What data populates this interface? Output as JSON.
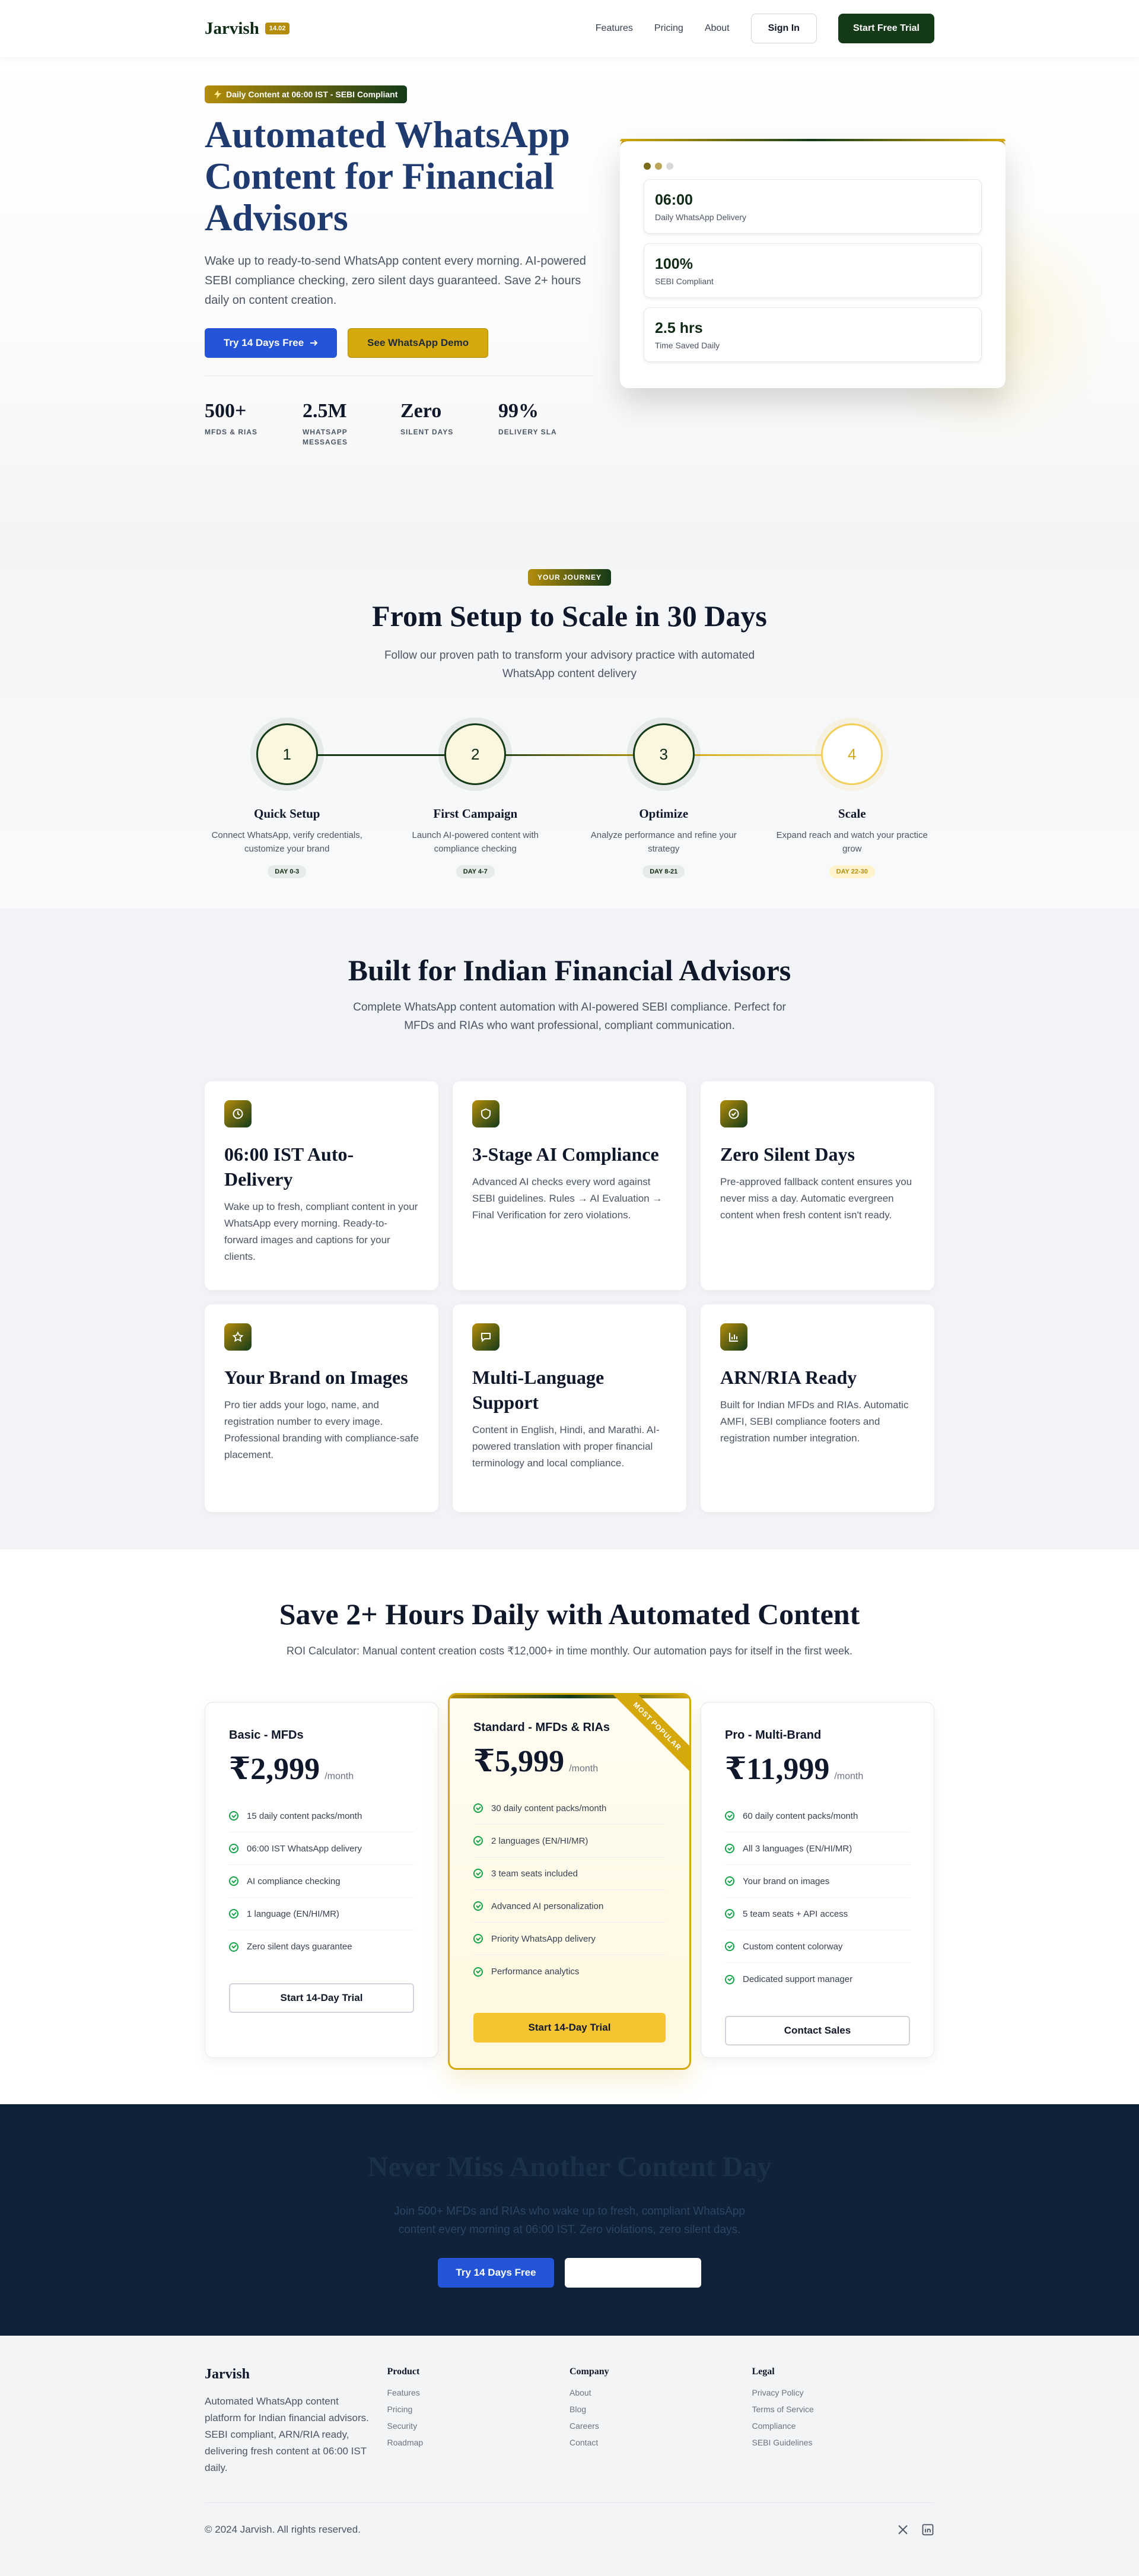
{
  "nav": {
    "brand": "Jarvish",
    "brand_badge": "14.02",
    "links": [
      "Features",
      "Pricing",
      "About"
    ],
    "signin": "Sign In",
    "trial": "Start Free Trial"
  },
  "hero": {
    "badge": "Daily Content at 06:00 IST - SEBI Compliant",
    "title": "Automated WhatsApp Content for Financial Advisors",
    "subtitle": "Wake up to ready-to-send WhatsApp content every morning. AI-powered SEBI compliance checking, zero silent days guaranteed. Save 2+ hours daily on content creation.",
    "cta_primary": "Try 14 Days Free",
    "cta_secondary": "See WhatsApp Demo",
    "stats": [
      {
        "value": "500+",
        "label": "MFDs & RIAs"
      },
      {
        "value": "2.5M",
        "label": "WhatsApp Messages"
      },
      {
        "value": "Zero",
        "label": "Silent Days"
      },
      {
        "value": "99%",
        "label": "Delivery SLA"
      }
    ],
    "mock_cards": [
      {
        "value": "06:00",
        "label": "Daily WhatsApp Delivery"
      },
      {
        "value": "100%",
        "label": "SEBI Compliant"
      },
      {
        "value": "2.5 hrs",
        "label": "Time Saved Daily"
      }
    ],
    "dot_colors": [
      "#7a6a1a",
      "#b8a55a",
      "#d7d7d7"
    ]
  },
  "journey": {
    "pill": "YOUR JOURNEY",
    "title": "From Setup to Scale in 30 Days",
    "subtitle": "Follow our proven path to transform your advisory practice with automated WhatsApp content delivery",
    "steps": [
      {
        "num": "1",
        "title": "Quick Setup",
        "desc": "Connect WhatsApp, verify credentials, customize your brand",
        "tag": "DAY 0-3"
      },
      {
        "num": "2",
        "title": "First Campaign",
        "desc": "Launch AI-powered content with compliance checking",
        "tag": "DAY 4-7"
      },
      {
        "num": "3",
        "title": "Optimize",
        "desc": "Analyze performance and refine your strategy",
        "tag": "DAY 8-21"
      },
      {
        "num": "4",
        "title": "Scale",
        "desc": "Expand reach and watch your practice grow",
        "tag": "DAY 22-30"
      }
    ]
  },
  "features": {
    "title": "Built for Indian Financial Advisors",
    "subtitle": "Complete WhatsApp content automation with AI-powered SEBI compliance. Perfect for MFDs and RIAs who want professional, compliant communication.",
    "items": [
      {
        "icon": "clock-icon",
        "title": "06:00 IST Auto-Delivery",
        "desc": "Wake up to fresh, compliant content in your WhatsApp every morning. Ready-to-forward images and captions for your clients."
      },
      {
        "icon": "shield-icon",
        "title": "3-Stage AI Compliance",
        "desc": "Advanced AI checks every word against SEBI guidelines. Rules → AI Evaluation → Final Verification for zero violations."
      },
      {
        "icon": "check-circle-icon",
        "title": "Zero Silent Days",
        "desc": "Pre-approved fallback content ensures you never miss a day. Automatic evergreen content when fresh content isn't ready."
      },
      {
        "icon": "star-icon",
        "title": "Your Brand on Images",
        "desc": "Pro tier adds your logo, name, and registration number to every image. Professional branding with compliance-safe placement."
      },
      {
        "icon": "chat-icon",
        "title": "Multi-Language Support",
        "desc": "Content in English, Hindi, and Marathi. AI-powered translation with proper financial terminology and local compliance."
      },
      {
        "icon": "chart-icon",
        "title": "ARN/RIA Ready",
        "desc": "Built for Indian MFDs and RIAs. Automatic AMFI, SEBI compliance footers and registration number integration."
      }
    ]
  },
  "pricing": {
    "title": "Save 2+ Hours Daily with Automated Content",
    "subtitle": "ROI Calculator: Manual content creation costs ₹12,000+ in time monthly. Our automation pays for itself in the first week.",
    "plans": [
      {
        "name": "Basic - MFDs",
        "price": "₹2,999",
        "per": "/month",
        "features": [
          "15 daily content packs/month",
          "06:00 IST WhatsApp delivery",
          "AI compliance checking",
          "1 language (EN/HI/MR)",
          "Zero silent days guarantee"
        ],
        "button": "Start 14-Day Trial"
      },
      {
        "name": "Standard - MFDs & RIAs",
        "price": "₹5,999",
        "per": "/month",
        "ribbon": "MOST POPULAR",
        "features": [
          "30 daily content packs/month",
          "2 languages (EN/HI/MR)",
          "3 team seats included",
          "Advanced AI personalization",
          "Priority WhatsApp delivery",
          "Performance analytics"
        ],
        "button": "Start 14-Day Trial"
      },
      {
        "name": "Pro - Multi-Brand",
        "price": "₹11,999",
        "per": "/month",
        "features": [
          "60 daily content packs/month",
          "All 3 languages (EN/HI/MR)",
          "Your brand on images",
          "5 team seats + API access",
          "Custom content colorway",
          "Dedicated support manager"
        ],
        "button": "Contact Sales"
      }
    ]
  },
  "cta": {
    "title": "Never Miss Another Content Day",
    "subtitle": "Join 500+ MFDs and RIAs who wake up to fresh, compliant WhatsApp content every morning at 06:00 IST. Zero violations, zero silent days.",
    "primary": "Try 14 Days Free"
  },
  "footer": {
    "brand": "Jarvish",
    "about": "Automated WhatsApp content platform for Indian financial advisors. SEBI compliant, ARN/RIA ready, delivering fresh content at 06:00 IST daily.",
    "columns": [
      {
        "heading": "Product",
        "links": [
          "Features",
          "Pricing",
          "Security",
          "Roadmap"
        ]
      },
      {
        "heading": "Company",
        "links": [
          "About",
          "Blog",
          "Careers",
          "Contact"
        ]
      },
      {
        "heading": "Legal",
        "links": [
          "Privacy Policy",
          "Terms of Service",
          "Compliance",
          "SEBI Guidelines"
        ]
      }
    ],
    "copyright": "© 2024 Jarvish. All rights reserved."
  }
}
